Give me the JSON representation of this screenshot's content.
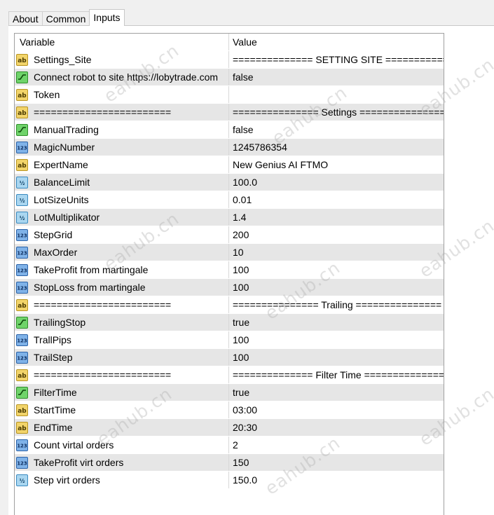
{
  "tabs": [
    {
      "label": "About",
      "active": false
    },
    {
      "label": "Common",
      "active": false
    },
    {
      "label": "Inputs",
      "active": true
    }
  ],
  "columns": {
    "variable": "Variable",
    "value": "Value"
  },
  "rows": [
    {
      "icon": "string",
      "name": "Settings_Site",
      "value": "============== SETTING SITE ============..."
    },
    {
      "icon": "bool",
      "name": "Connect robot to site https://lobytrade.com",
      "value": "false"
    },
    {
      "icon": "string",
      "name": "Token",
      "value": ""
    },
    {
      "icon": "string",
      "name": "========================",
      "value": "=============== Settings ==============="
    },
    {
      "icon": "bool",
      "name": "ManualTrading",
      "value": "false"
    },
    {
      "icon": "int",
      "name": "MagicNumber",
      "value": "1245786354"
    },
    {
      "icon": "string",
      "name": "ExpertName",
      "value": "New Genius AI FTMO"
    },
    {
      "icon": "double",
      "name": "BalanceLimit",
      "value": "100.0"
    },
    {
      "icon": "double",
      "name": "LotSizeUnits",
      "value": "0.01"
    },
    {
      "icon": "double",
      "name": "LotMultiplikator",
      "value": "1.4"
    },
    {
      "icon": "int",
      "name": "StepGrid",
      "value": "200"
    },
    {
      "icon": "int",
      "name": "MaxOrder",
      "value": "10"
    },
    {
      "icon": "int",
      "name": "TakeProfit from martingale",
      "value": "100"
    },
    {
      "icon": "int",
      "name": "StopLoss from martingale",
      "value": "100"
    },
    {
      "icon": "string",
      "name": "========================",
      "value": "=============== Trailing ==============="
    },
    {
      "icon": "bool",
      "name": "TrailingStop",
      "value": "true"
    },
    {
      "icon": "int",
      "name": "TrallPips",
      "value": "100"
    },
    {
      "icon": "int",
      "name": "TrailStep",
      "value": "100"
    },
    {
      "icon": "string",
      "name": "========================",
      "value": "============== Filter Time =============="
    },
    {
      "icon": "bool",
      "name": "FilterTime",
      "value": "true"
    },
    {
      "icon": "string",
      "name": "StartTime",
      "value": "03:00"
    },
    {
      "icon": "string",
      "name": "EndTime",
      "value": "20:30"
    },
    {
      "icon": "int",
      "name": "Count virtal orders",
      "value": "2"
    },
    {
      "icon": "int",
      "name": "TakeProfit virt orders",
      "value": "150"
    },
    {
      "icon": "double",
      "name": "Step virt orders",
      "value": "150.0"
    }
  ],
  "watermark": "eahub.cn"
}
